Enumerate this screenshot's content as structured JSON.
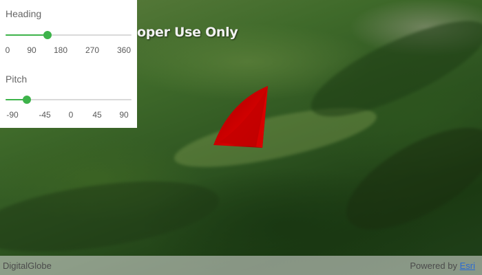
{
  "watermark": "oper Use Only",
  "controls": {
    "heading": {
      "label": "Heading",
      "value": 120,
      "min": 0,
      "max": 360,
      "ticks": [
        "0",
        "90",
        "180",
        "270",
        "360"
      ]
    },
    "pitch": {
      "label": "Pitch",
      "value": -60,
      "min": -90,
      "max": 90,
      "ticks": [
        "-90",
        "-45",
        "0",
        "45",
        "90"
      ]
    },
    "accent_color": "#3db34a"
  },
  "scene": {
    "graphic_color": "#d40000"
  },
  "attribution": {
    "source": "DigitalGlobe",
    "powered_by": "Powered by",
    "esri": "Esri"
  }
}
